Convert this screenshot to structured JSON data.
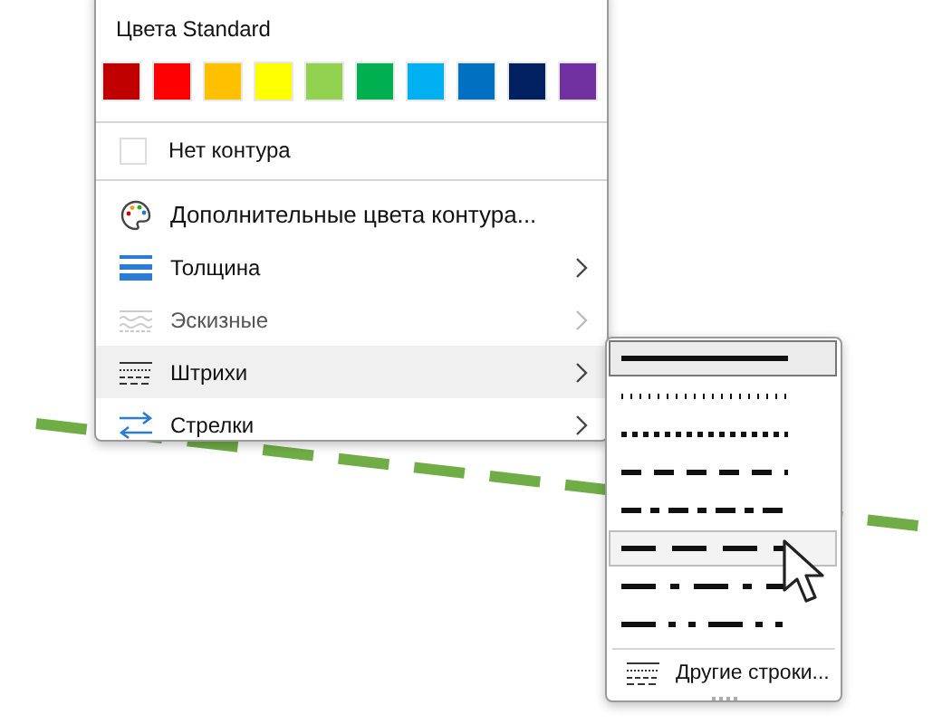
{
  "color_menu": {
    "heading": "Цвета Standard",
    "swatches": [
      {
        "color": "#c00000"
      },
      {
        "color": "#ff0000"
      },
      {
        "color": "#ffc000"
      },
      {
        "color": "#ffff00"
      },
      {
        "color": "#92d050"
      },
      {
        "color": "#00b050"
      },
      {
        "color": "#00b0f0"
      },
      {
        "color": "#0070c0"
      },
      {
        "color": "#002060"
      },
      {
        "color": "#7030a0"
      }
    ],
    "no_outline": {
      "label": "Нет контура",
      "checked": false
    },
    "items": [
      {
        "kind": "palette",
        "label": "Дополнительные цвета контура...",
        "submenu": false,
        "disabled": false,
        "selected": false
      },
      {
        "kind": "weight",
        "label": "Толщина",
        "submenu": true,
        "disabled": false,
        "selected": false
      },
      {
        "kind": "sketch",
        "label": "Эскизные",
        "submenu": true,
        "disabled": true,
        "selected": false
      },
      {
        "kind": "dashes",
        "label": "Штрихи",
        "submenu": true,
        "disabled": false,
        "selected": true
      },
      {
        "kind": "arrows",
        "label": "Стрелки",
        "submenu": true,
        "disabled": false,
        "selected": false
      }
    ]
  },
  "dash_menu": {
    "styles": [
      {
        "kind": "solid",
        "selected": true,
        "hovered": false
      },
      {
        "kind": "round-dot",
        "selected": false,
        "hovered": false
      },
      {
        "kind": "square-dot",
        "selected": false,
        "hovered": false
      },
      {
        "kind": "dash",
        "selected": false,
        "hovered": false
      },
      {
        "kind": "dash-dot",
        "selected": false,
        "hovered": false
      },
      {
        "kind": "long-dash",
        "selected": false,
        "hovered": true
      },
      {
        "kind": "long-dash-dot",
        "selected": false,
        "hovered": false
      },
      {
        "kind": "long-dash-dot-dot",
        "selected": false,
        "hovered": false
      }
    ],
    "more": "Другие строки..."
  }
}
